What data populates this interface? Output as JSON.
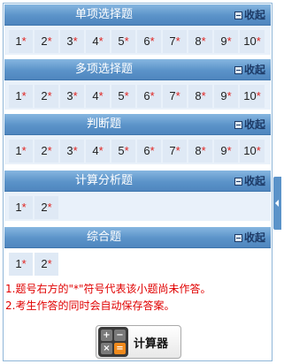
{
  "collapse_label": "收起",
  "sections": [
    {
      "title": "单项选择题",
      "questions": [
        "1",
        "2",
        "3",
        "4",
        "5",
        "6",
        "7",
        "8",
        "9",
        "10"
      ]
    },
    {
      "title": "多项选择题",
      "questions": [
        "1",
        "2",
        "3",
        "4",
        "5",
        "6",
        "7",
        "8",
        "9",
        "10"
      ]
    },
    {
      "title": "判断题",
      "questions": [
        "1",
        "2",
        "3",
        "4",
        "5",
        "6",
        "7",
        "8",
        "9",
        "10"
      ]
    },
    {
      "title": "计算分析题",
      "questions": [
        "1",
        "2"
      ]
    },
    {
      "title": "综合题",
      "questions": [
        "1",
        "2"
      ]
    }
  ],
  "unanswered_mark": "*",
  "notes": [
    "1.题号右方的\"*\"符号代表该小题尚未作答。",
    "2.考生作答的同时会自动保存答案。"
  ],
  "calculator": {
    "label": "计算器",
    "icon": "calculator-icon"
  },
  "colors": {
    "header": "#5b93c9",
    "star": "#e0231f",
    "note": "#e00000",
    "cell_bg": "#dfe9f5"
  }
}
